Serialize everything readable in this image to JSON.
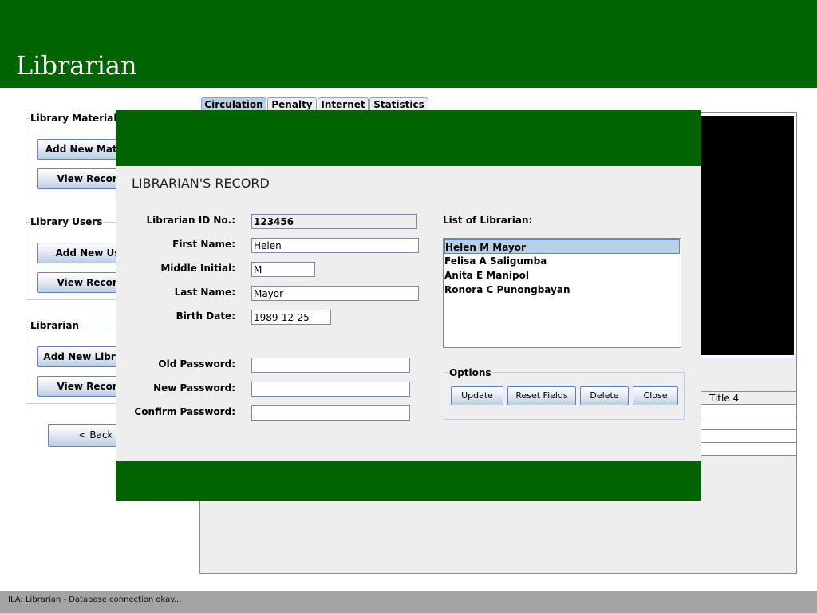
{
  "header": {
    "title": "Librarian"
  },
  "sidebar": {
    "groups": [
      {
        "title": "Library Materials",
        "buttons": [
          "Add New Material",
          "View Records"
        ]
      },
      {
        "title": "Library Users",
        "buttons": [
          "Add New User",
          "View Records"
        ]
      },
      {
        "title": "Librarian",
        "buttons": [
          "Add New Librarian",
          "View Records"
        ]
      }
    ],
    "back_label": "< Back"
  },
  "tabs": [
    "Circulation",
    "Penalty",
    "Internet",
    "Statistics"
  ],
  "background_table": {
    "header": "Title 4"
  },
  "dialog": {
    "title": "LIBRARIAN'S RECORD",
    "fields": {
      "librarian_id": {
        "label": "Librarian ID No.:",
        "value": "123456"
      },
      "first_name": {
        "label": "First Name:",
        "value": "Helen"
      },
      "middle_initial": {
        "label": "Middle Initial:",
        "value": "M"
      },
      "last_name": {
        "label": "Last Name:",
        "value": "Mayor"
      },
      "birth_date": {
        "label": "Birth Date:",
        "value": "1989-12-25"
      },
      "old_password": {
        "label": "Old Password:",
        "value": ""
      },
      "new_password": {
        "label": "New Password:",
        "value": ""
      },
      "confirm_password": {
        "label": "Confirm Password:",
        "value": ""
      }
    },
    "list_label": "List of Librarian:",
    "librarians": [
      "Helen M Mayor",
      "Felisa A Saligumba",
      "Anita E Manipol",
      "Ronora C Punongbayan"
    ],
    "options": {
      "title": "Options",
      "update": "Update",
      "reset": "Reset Fields",
      "delete": "Delete",
      "close": "Close"
    }
  },
  "status": {
    "text": "ILA: Librarian - Database connection okay..."
  },
  "colors": {
    "header_green": "#006400",
    "selection": "#b8cfe5",
    "status_bar": "#a3a3a3"
  }
}
